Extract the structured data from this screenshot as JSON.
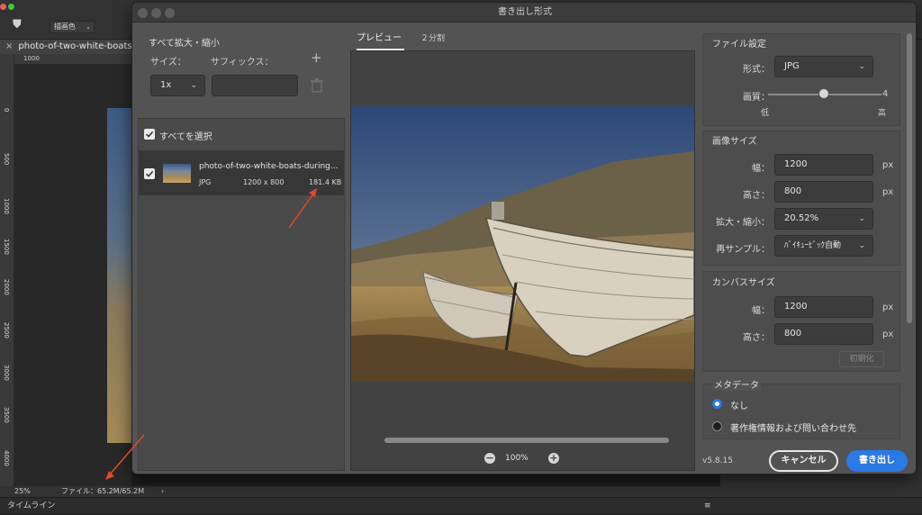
{
  "app": {
    "doc_tab": "photo-of-two-white-boats-",
    "toolbar_preset": "描画色",
    "ruler_h": [
      "1000"
    ],
    "ruler_v": [
      "0",
      "500",
      "1000",
      "1500",
      "2000",
      "2500",
      "3000",
      "3500",
      "4000"
    ],
    "status_zoom": "25%",
    "status_file": "ファイル：65.2M/65.2M",
    "timeline_label": "タイムライン"
  },
  "dialog": {
    "title": "書き出し形式",
    "version": "v5.8.15",
    "scale": {
      "section_label": "すべて拡大・縮小",
      "size_header": "サイズ：",
      "suffix_header": "サフィックス：",
      "scale_value": "1x",
      "suffix_value": ""
    },
    "files": {
      "select_all_label": "すべてを選択",
      "items": [
        {
          "name": "photo-of-two-white-boats-during...",
          "format": "JPG",
          "dimensions": "1200 x 800",
          "size": "181.4 KB"
        }
      ]
    },
    "preview": {
      "tab_preview": "プレビュー",
      "tab_split": "２分割",
      "zoom_value": "100%"
    },
    "file_settings": {
      "title": "ファイル設定",
      "format_label": "形式：",
      "format_value": "JPG",
      "quality_label": "画質：",
      "quality_value": "4",
      "quality_low": "低",
      "quality_high": "高"
    },
    "image_size": {
      "title": "画像サイズ",
      "width_label": "幅：",
      "width_value": "1200",
      "height_label": "高さ：",
      "height_value": "800",
      "unit": "px",
      "scale_label": "拡大・縮小：",
      "scale_value": "20.52%",
      "resample_label": "再サンプル：",
      "resample_value": "ﾊﾞｲｷｭｰﾋﾞｯｸ自動"
    },
    "canvas_size": {
      "title": "カンバスサイズ",
      "width_label": "幅：",
      "width_value": "1200",
      "height_label": "高さ：",
      "height_value": "800",
      "unit": "px",
      "reset_label": "初期化"
    },
    "metadata": {
      "title": "メタデータ",
      "options": [
        "なし",
        "著作権情報および問い合わせ先"
      ],
      "selected": "なし"
    },
    "buttons": {
      "cancel": "キャンセル",
      "export": "書き出し"
    }
  },
  "colors": {
    "accent": "#2a79e4",
    "annotation_arrow": "#e4472a"
  }
}
